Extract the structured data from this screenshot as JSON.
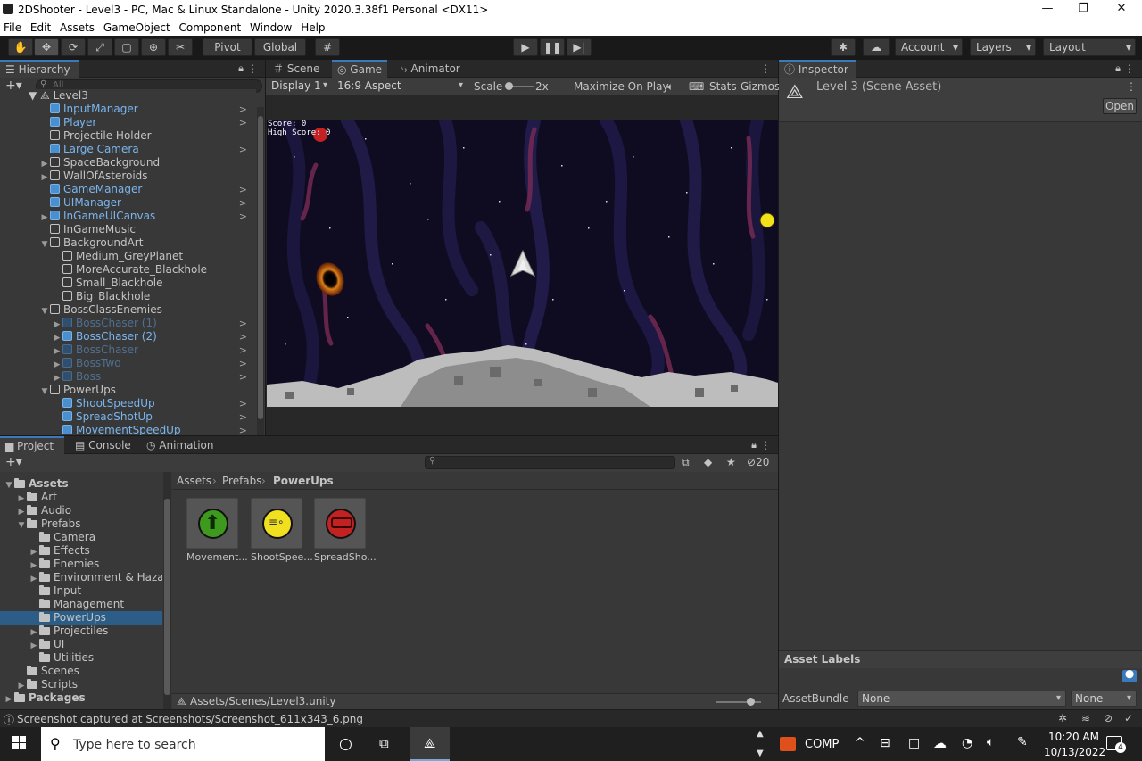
{
  "window": {
    "title": "2DShooter - Level3 - PC, Mac & Linux Standalone - Unity 2020.3.38f1 Personal <DX11>"
  },
  "menu": [
    "File",
    "Edit",
    "Assets",
    "GameObject",
    "Component",
    "Window",
    "Help"
  ],
  "toolbar": {
    "pivot": "Pivot",
    "global": "Global",
    "account": "Account",
    "layers": "Layers",
    "layout": "Layout"
  },
  "hierarchy": {
    "tab": "Hierarchy",
    "search_placeholder": "All",
    "root": "Level3",
    "rows": [
      {
        "label": "InputManager",
        "style": "blue",
        "indent": 1,
        "expand": "",
        "chev": true
      },
      {
        "label": "Player",
        "style": "blue",
        "indent": 1,
        "expand": "",
        "chev": true
      },
      {
        "label": "Projectile Holder",
        "style": "normal",
        "indent": 1,
        "expand": "",
        "chev": false
      },
      {
        "label": "Large Camera",
        "style": "blue",
        "indent": 1,
        "expand": "",
        "chev": true
      },
      {
        "label": "SpaceBackground",
        "style": "normal",
        "indent": 1,
        "expand": "▶",
        "chev": false
      },
      {
        "label": "WallOfAsteroids",
        "style": "normal",
        "indent": 1,
        "expand": "▶",
        "chev": false
      },
      {
        "label": "GameManager",
        "style": "blue",
        "indent": 1,
        "expand": "",
        "chev": true
      },
      {
        "label": "UIManager",
        "style": "blue",
        "indent": 1,
        "expand": "",
        "chev": true
      },
      {
        "label": "InGameUICanvas",
        "style": "blue",
        "indent": 1,
        "expand": "▶",
        "chev": true
      },
      {
        "label": "InGameMusic",
        "style": "normal",
        "indent": 1,
        "expand": "",
        "chev": false
      },
      {
        "label": "BackgroundArt",
        "style": "normal",
        "indent": 1,
        "expand": "▼",
        "chev": false
      },
      {
        "label": "Medium_GreyPlanet",
        "style": "normal",
        "indent": 2,
        "expand": "",
        "chev": false
      },
      {
        "label": "MoreAccurate_Blackhole",
        "style": "normal",
        "indent": 2,
        "expand": "",
        "chev": false
      },
      {
        "label": "Small_Blackhole",
        "style": "normal",
        "indent": 2,
        "expand": "",
        "chev": false
      },
      {
        "label": "Big_Blackhole",
        "style": "normal",
        "indent": 2,
        "expand": "",
        "chev": false
      },
      {
        "label": "BossClassEnemies",
        "style": "normal",
        "indent": 1,
        "expand": "▼",
        "chev": false
      },
      {
        "label": "BossChaser (1)",
        "style": "dim",
        "indent": 2,
        "expand": "▶",
        "chev": true
      },
      {
        "label": "BossChaser (2)",
        "style": "blue",
        "indent": 2,
        "expand": "▶",
        "chev": true
      },
      {
        "label": "BossChaser",
        "style": "dim",
        "indent": 2,
        "expand": "▶",
        "chev": true
      },
      {
        "label": "BossTwo",
        "style": "dim",
        "indent": 2,
        "expand": "▶",
        "chev": true
      },
      {
        "label": "Boss",
        "style": "dim",
        "indent": 2,
        "expand": "▶",
        "chev": true
      },
      {
        "label": "PowerUps",
        "style": "normal",
        "indent": 1,
        "expand": "▼",
        "chev": false
      },
      {
        "label": "ShootSpeedUp",
        "style": "blue",
        "indent": 2,
        "expand": "",
        "chev": true
      },
      {
        "label": "SpreadShotUp",
        "style": "blue",
        "indent": 2,
        "expand": "",
        "chev": true
      },
      {
        "label": "MovementSpeedUp",
        "style": "blue",
        "indent": 2,
        "expand": "",
        "chev": true
      }
    ]
  },
  "game_view": {
    "tabs": [
      "Scene",
      "Game",
      "Animator"
    ],
    "display": "Display 1",
    "aspect": "16:9 Aspect",
    "scale_label": "Scale",
    "scale_value": "2x",
    "maximize": "Maximize On Play",
    "stats": "Stats",
    "gizmos": "Gizmos",
    "score": "Score: 0",
    "high_score": "High Score: 0"
  },
  "inspector": {
    "tab": "Inspector",
    "asset_title": "Level 3 (Scene Asset)",
    "open": "Open",
    "asset_labels": "Asset Labels",
    "assetbundle_label": "AssetBundle",
    "assetbundle_value": "None",
    "variant_value": "None"
  },
  "project": {
    "tabs": [
      "Project",
      "Console",
      "Animation"
    ],
    "hidden_count": "20",
    "breadcrumb": [
      "Assets",
      "Prefabs",
      "PowerUps"
    ],
    "tree": [
      {
        "label": "Assets",
        "indent": 0,
        "expand": "▼",
        "bold": true
      },
      {
        "label": "Art",
        "indent": 1,
        "expand": "▶"
      },
      {
        "label": "Audio",
        "indent": 1,
        "expand": "▶"
      },
      {
        "label": "Prefabs",
        "indent": 1,
        "expand": "▼"
      },
      {
        "label": "Camera",
        "indent": 2,
        "expand": ""
      },
      {
        "label": "Effects",
        "indent": 2,
        "expand": "▶"
      },
      {
        "label": "Enemies",
        "indent": 2,
        "expand": "▶"
      },
      {
        "label": "Environment & Hazards",
        "indent": 2,
        "expand": "▶"
      },
      {
        "label": "Input",
        "indent": 2,
        "expand": ""
      },
      {
        "label": "Management",
        "indent": 2,
        "expand": ""
      },
      {
        "label": "PowerUps",
        "indent": 2,
        "expand": "",
        "selected": true
      },
      {
        "label": "Projectiles",
        "indent": 2,
        "expand": "▶"
      },
      {
        "label": "UI",
        "indent": 2,
        "expand": "▶"
      },
      {
        "label": "Utilities",
        "indent": 2,
        "expand": ""
      },
      {
        "label": "Scenes",
        "indent": 1,
        "expand": ""
      },
      {
        "label": "Scripts",
        "indent": 1,
        "expand": "▶"
      },
      {
        "label": "Packages",
        "indent": 0,
        "expand": "▶",
        "bold": true
      }
    ],
    "assets": [
      {
        "label": "Movement...",
        "color": "#3d9a1f"
      },
      {
        "label": "ShootSpee...",
        "color": "#f0e020"
      },
      {
        "label": "SpreadSho...",
        "color": "#c22222"
      }
    ],
    "footer_path": "Assets/Scenes/Level3.unity"
  },
  "status": {
    "text": "Screenshot captured at Screenshots/Screenshot_611x343_6.png"
  },
  "taskbar": {
    "search_placeholder": "Type here to search",
    "comp": "COMP",
    "time": "10:20 AM",
    "date": "10/13/2022",
    "notif_count": "4"
  }
}
